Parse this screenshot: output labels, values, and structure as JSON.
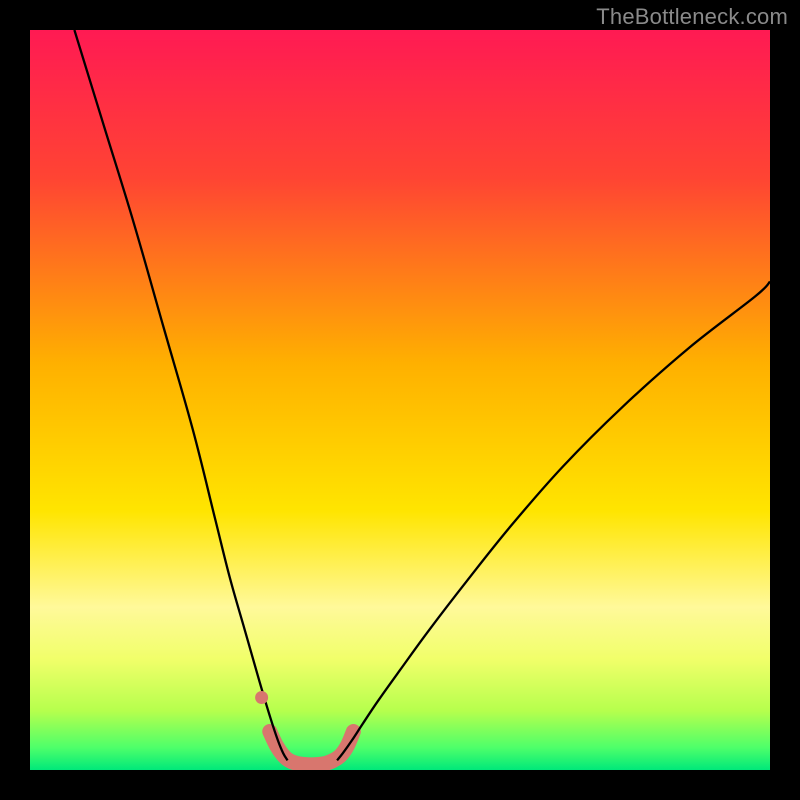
{
  "watermark": {
    "text": "TheBottleneck.com"
  },
  "chart_data": {
    "type": "line",
    "title": "",
    "xlabel": "",
    "ylabel": "",
    "xlim": [
      0,
      100
    ],
    "ylim": [
      0,
      100
    ],
    "grid": false,
    "legend": false,
    "background_gradient": {
      "stops": [
        {
          "offset": 0.0,
          "color": "#ff1a53"
        },
        {
          "offset": 0.2,
          "color": "#ff4433"
        },
        {
          "offset": 0.45,
          "color": "#ffb000"
        },
        {
          "offset": 0.65,
          "color": "#ffe500"
        },
        {
          "offset": 0.78,
          "color": "#fff99a"
        },
        {
          "offset": 0.85,
          "color": "#f1ff6a"
        },
        {
          "offset": 0.92,
          "color": "#b6ff4d"
        },
        {
          "offset": 0.97,
          "color": "#4dff6a"
        },
        {
          "offset": 1.0,
          "color": "#00e87a"
        }
      ]
    },
    "series": [
      {
        "name": "curve-left",
        "stroke": "#000000",
        "stroke_width": 2.3,
        "x": [
          6,
          10,
          14,
          18,
          22,
          25,
          27,
          29,
          31,
          32.5,
          33.5,
          34.2,
          34.8
        ],
        "y": [
          100,
          87,
          74,
          60,
          46,
          34,
          26,
          19,
          12,
          7,
          4,
          2.3,
          1.3
        ]
      },
      {
        "name": "curve-right",
        "stroke": "#000000",
        "stroke_width": 2.3,
        "x": [
          41.5,
          42.3,
          43.5,
          45,
          47,
          50,
          54,
          59,
          65,
          72,
          80,
          89,
          98,
          100
        ],
        "y": [
          1.3,
          2.3,
          4,
          6.3,
          9.3,
          13.5,
          19,
          25.5,
          33,
          41,
          49,
          57,
          64,
          66
        ]
      },
      {
        "name": "bottom-band",
        "stroke": "#d8766e",
        "stroke_width": 15,
        "linecap": "round",
        "x": [
          32.4,
          33.3,
          34.2,
          35.0,
          36.0,
          37.0,
          38.0,
          39.0,
          40.0,
          41.0,
          42.0,
          42.9,
          43.7
        ],
        "y": [
          5.2,
          3.3,
          2.0,
          1.3,
          0.9,
          0.75,
          0.7,
          0.75,
          0.9,
          1.3,
          2.0,
          3.3,
          5.2
        ]
      },
      {
        "name": "dot",
        "type": "scatter",
        "stroke": "#d8766e",
        "fill": "#d8766e",
        "radius": 6.5,
        "x": [
          31.3
        ],
        "y": [
          9.8
        ]
      }
    ]
  }
}
